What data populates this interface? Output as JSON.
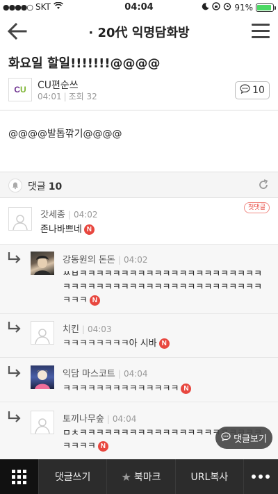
{
  "status_bar": {
    "carrier": "SKT",
    "time": "04:04",
    "battery": "91%"
  },
  "header": {
    "title": "· 20代 익명담화방"
  },
  "post": {
    "title": "화요일 할일!!!!!!!@@@@",
    "author": "CU편순쓰",
    "logo_text_c": "C",
    "logo_text_u": "U",
    "time": "04:01",
    "views": "조회 32",
    "comment_count": "10",
    "body": "@@@@발톱깎기@@@@"
  },
  "comments_header": {
    "label": "댓글",
    "count": "10"
  },
  "comments": [
    {
      "name": "갓세종",
      "time": "04:02",
      "text": "존나바쁘네",
      "badge": "N",
      "tag": "첫댓글"
    },
    {
      "name": "강동원의 돈돈",
      "time": "04:02",
      "text": "ㅆㅂㅋㅋㅋㅋㅋㅋㅋㅋㅋㅋㅋㅋㅋㅋㅋㅋㅋㅋㅋㅋㅋㅋㅋㅋㅋㅋㅋㅋㅋㅋㅋㅋㅋㅋㅋㅋㅋㅋㅋㅋㅋㅋㅋㅋㅋㅋㅋㅋㅋ",
      "badge": "N"
    },
    {
      "name": "치킨",
      "time": "04:03",
      "text": "ㅋㅋㅋㅋㅋㅋㅋㅋ아 시바",
      "badge": "N"
    },
    {
      "name": "익담 마스코트",
      "time": "04:04",
      "text": "ㅋㅋㅋㅋㅋㅋㅋㅋㅋㅋㅋㅋㅋㅋ",
      "badge": "N"
    },
    {
      "name": "토끼나무숲",
      "time": "04:04",
      "text": "ㅁㅊㅋㅋㅋㅋㅋㅋㅋㅋㅋㅋㅋㅋㅋㅋㅋㅋㅋㅋㅋㅋㅋㅋㅋㅋㅋㅋ",
      "badge": "N"
    }
  ],
  "float_button": {
    "label": "댓글보기"
  },
  "bottom_bar": {
    "write_comment": "댓글쓰기",
    "bookmark": "북마크",
    "copy_url": "URL복사"
  },
  "colors": {
    "badge_red": "#e8473f",
    "bottom_bar": "#2c2c2c",
    "cu_purple": "#6b2d8e",
    "cu_green": "#7ab32e"
  }
}
